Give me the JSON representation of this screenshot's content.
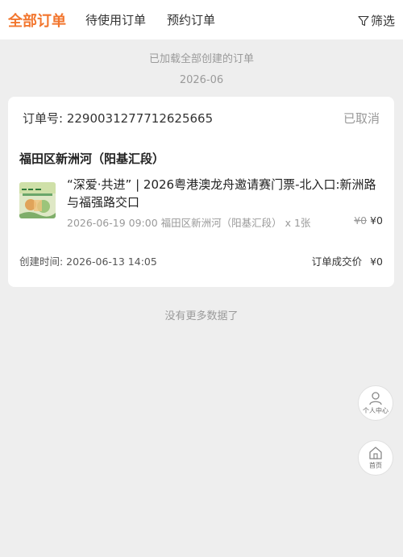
{
  "header": {
    "tabs": [
      {
        "label": "全部订单",
        "active": true
      },
      {
        "label": "待使用订单",
        "active": false
      },
      {
        "label": "预约订单",
        "active": false
      }
    ],
    "filter_label": "筛选",
    "filter_icon": "filter-icon",
    "accent_color": "#f2762e"
  },
  "list": {
    "loaded_hint": "已加载全部创建的订单",
    "month_label": "2026-06",
    "end_hint": "没有更多数据了"
  },
  "order": {
    "number_label": "订单号: 2290031277712625665",
    "status": "已取消",
    "venue": "福田区新洲河（阳基汇段）",
    "item": {
      "title": "“深爱·共进” | 2026粤港澳龙舟邀请赛门票-北入口:新洲路与福强路交口",
      "meta": "2026-06-19 09:00 福田区新洲河（阳基汇段）  x 1张",
      "original_price": "¥0",
      "price": "¥0",
      "thumbnail_icon": "event-poster-thumbnail"
    },
    "created_label": "创建时间: 2026-06-13 14:05",
    "deal_label": "订单成交价",
    "deal_amount": "¥0"
  },
  "floating": {
    "profile_label": "个人中心",
    "profile_icon": "user-icon",
    "home_label": "首页",
    "home_icon": "home-icon"
  }
}
